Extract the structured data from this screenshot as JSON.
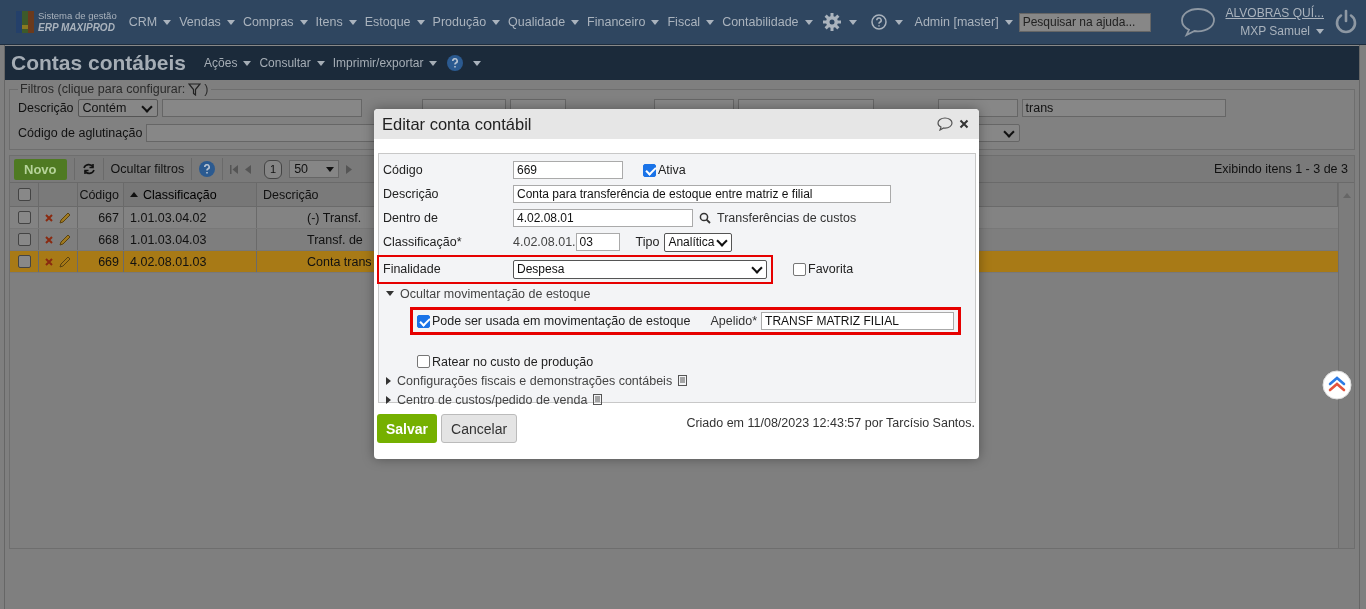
{
  "brand": {
    "line1": "Sistema de gestão",
    "line2": "ERP MAXIPROD"
  },
  "menu": [
    {
      "label": "CRM"
    },
    {
      "label": "Vendas"
    },
    {
      "label": "Compras"
    },
    {
      "label": "Itens"
    },
    {
      "label": "Estoque"
    },
    {
      "label": "Produção"
    },
    {
      "label": "Qualidade"
    },
    {
      "label": "Financeiro"
    },
    {
      "label": "Fiscal"
    },
    {
      "label": "Contabilidade"
    }
  ],
  "admin": "Admin [master]",
  "help_search": {
    "placeholder": "Pesquisar na ajuda..."
  },
  "company": "ALVOBRAS QUÍ...",
  "user": "MXP Samuel",
  "page": {
    "title": "Contas contábeis",
    "menus": [
      "Ações",
      "Consultar",
      "Imprimir/exportar"
    ]
  },
  "filters": {
    "legend": "Filtros (clique para configurar:",
    "legend_end": ")",
    "description_label": "Descrição",
    "description_mode": "Contém",
    "nickname_value": "trans",
    "grouping_label": "Código de aglutinação"
  },
  "toolbar": {
    "new": "Novo",
    "hide_filters": "Ocultar filtros",
    "page": "1",
    "page_size": "50",
    "summary": "Exibindo itens 1 - 3 de 3"
  },
  "table": {
    "all_checked": false,
    "columns": [
      {
        "label": "Código",
        "sorted": false
      },
      {
        "label": "Classificação",
        "sorted": true
      },
      {
        "label": "Descrição",
        "sorted": false
      }
    ],
    "rows": [
      {
        "checked": false,
        "code": "667",
        "classification": "1.01.03.04.02",
        "description": "(-) Transf.",
        "selected": false
      },
      {
        "checked": false,
        "code": "668",
        "classification": "1.01.03.04.03",
        "description": "Transf. de",
        "selected": false
      },
      {
        "checked": false,
        "code": "669",
        "classification": "4.02.08.01.03",
        "description": "Conta trans",
        "selected": true
      }
    ]
  },
  "dialog": {
    "title": "Editar conta contábil",
    "code_label": "Código",
    "code": "669",
    "active_label": "Ativa",
    "active": true,
    "description_label": "Descrição",
    "description": "Conta para transferência de estoque entre matriz e filial",
    "parent_label": "Dentro de",
    "parent": "4.02.08.01",
    "parent_name": "Transferências de custos",
    "classification_label": "Classificação*",
    "classification_prefix": "4.02.08.01.",
    "classification_suffix": "03",
    "type_label": "Tipo",
    "type": "Analítica",
    "purpose_label": "Finalidade",
    "purpose": "Despesa",
    "purpose_highlighted": true,
    "favorite_label": "Favorita",
    "favorite": false,
    "stock_section": {
      "label": "Ocultar movimentação de estoque",
      "expanded": true
    },
    "stock_use": {
      "label": "Pode ser usada em movimentação de estoque",
      "checked": true,
      "highlighted": true
    },
    "nickname_label": "Apelido*",
    "nickname": "TRANSF MATRIZ FILIAL",
    "apportion": {
      "label": "Ratear no custo de produção",
      "checked": false
    },
    "sections": [
      {
        "label": "Configurações fiscais e demonstrações contábeis",
        "expanded": false
      },
      {
        "label": "Centro de custos/pedido de venda",
        "expanded": false
      }
    ],
    "created": "Criado em 11/08/2023 12:43:57 por Tarcísio Santos.",
    "save": "Salvar",
    "cancel": "Cancelar"
  }
}
